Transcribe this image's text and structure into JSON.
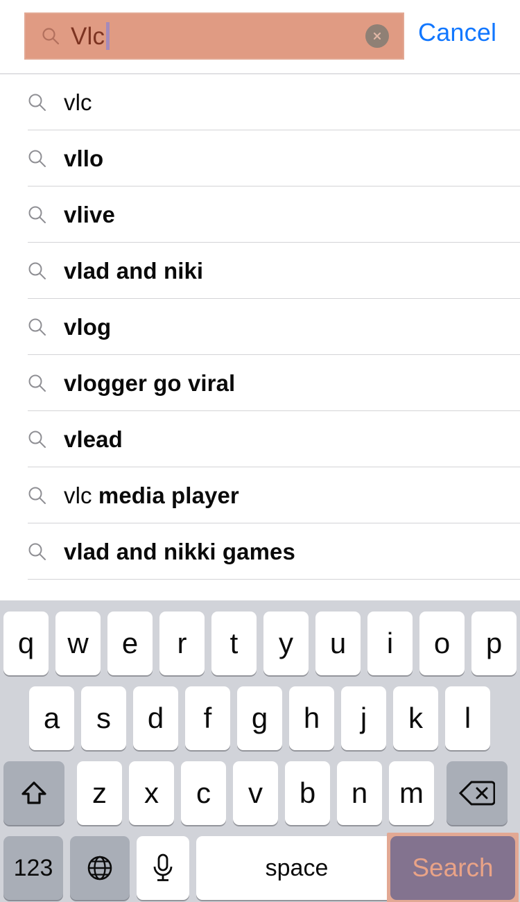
{
  "search": {
    "value": "Vlc",
    "placeholder": "Search",
    "magnifier_icon": "search-icon",
    "clear_icon": "clear-circle-icon",
    "cancel_label": "Cancel",
    "field_highlight_color": "#e09b83",
    "cancel_color": "#1177ff",
    "caret_color": "#a58aba"
  },
  "suggestions": [
    {
      "icon": "search-icon",
      "prefix": "vlc",
      "bold": "",
      "weight": "plain"
    },
    {
      "icon": "search-icon",
      "prefix": "",
      "bold": "vllo",
      "weight": "bold"
    },
    {
      "icon": "search-icon",
      "prefix": "",
      "bold": "vlive",
      "weight": "bold"
    },
    {
      "icon": "search-icon",
      "prefix": "",
      "bold": "vlad and niki",
      "weight": "bold"
    },
    {
      "icon": "search-icon",
      "prefix": "",
      "bold": "vlog",
      "weight": "bold"
    },
    {
      "icon": "search-icon",
      "prefix": "",
      "bold": "vlogger go viral",
      "weight": "bold"
    },
    {
      "icon": "search-icon",
      "prefix": "",
      "bold": "vlead",
      "weight": "bold"
    },
    {
      "icon": "search-icon",
      "prefix": "vlc ",
      "bold": "media player",
      "weight": "mixed"
    },
    {
      "icon": "search-icon",
      "prefix": "",
      "bold": "vlad and nikki games",
      "weight": "bold"
    }
  ],
  "keyboard": {
    "background_color": "#d1d3d9",
    "row1": [
      "q",
      "w",
      "e",
      "r",
      "t",
      "y",
      "u",
      "i",
      "o",
      "p"
    ],
    "row2": [
      "a",
      "s",
      "d",
      "f",
      "g",
      "h",
      "j",
      "k",
      "l"
    ],
    "row3": [
      "z",
      "x",
      "c",
      "v",
      "b",
      "n",
      "m"
    ],
    "shift_icon": "shift-arrow-icon",
    "delete_icon": "backspace-icon",
    "numbers_label": "123",
    "globe_icon": "globe-icon",
    "mic_icon": "microphone-icon",
    "space_label": "space",
    "search_label": "Search",
    "search_key_bg": "#83738f",
    "search_key_text_color": "#e9a387",
    "search_key_border_color": "#e2a893"
  }
}
